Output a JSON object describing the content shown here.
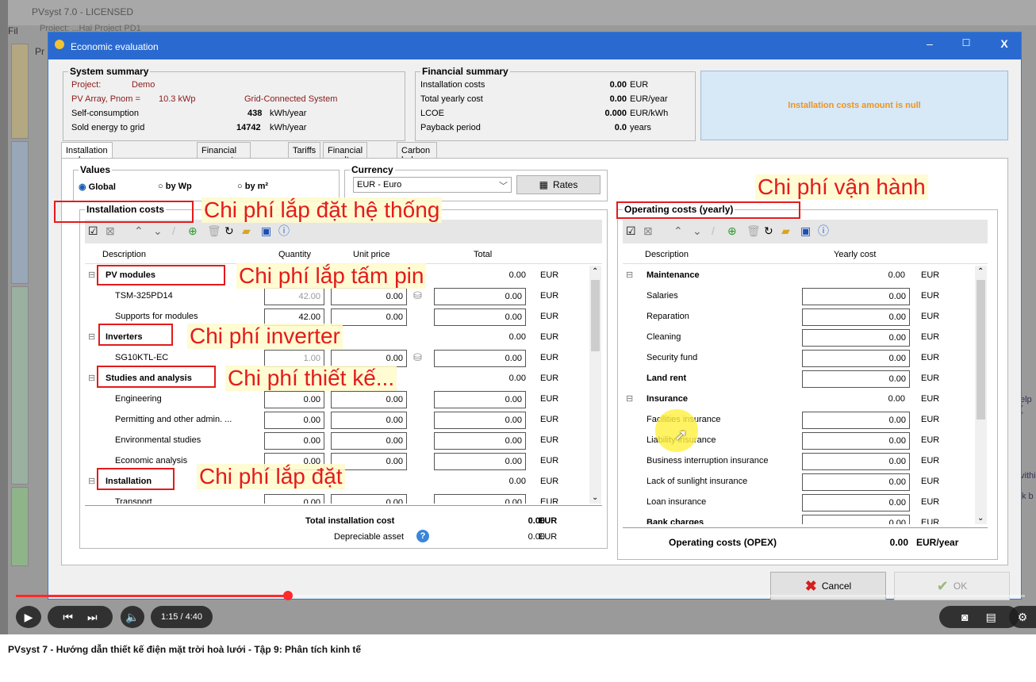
{
  "app": {
    "title": "PVsyst 7.0 - LICENSED",
    "menu": "Fil",
    "project_tab": "Pr",
    "project_bar": "Project: ...Hai Project PD1",
    "right_text_1": "elp (",
    "right_text_2": "vithi",
    "right_text_3": "k b"
  },
  "dialog": {
    "title": "Economic evaluation",
    "minimize": "–",
    "maximize": "☐",
    "close": "X"
  },
  "system_summary": {
    "legend": "System summary",
    "project_label": "Project:",
    "project_value": "Demo",
    "pv_label": "PV Array, Pnom =",
    "pv_value": "10.3 kWp",
    "pv_type": "Grid-Connected System",
    "selfc_label": "Self-consumption",
    "selfc_value": "438",
    "selfc_unit": "kWh/year",
    "sold_label": "Sold energy to grid",
    "sold_value": "14742",
    "sold_unit": "kWh/year"
  },
  "financial_summary": {
    "legend": "Financial summary",
    "rows": [
      {
        "label": "Installation costs",
        "value": "0.00",
        "unit": "EUR"
      },
      {
        "label": "Total yearly cost",
        "value": "0.00",
        "unit": "EUR/year"
      },
      {
        "label": "LCOE",
        "value": "0.000",
        "unit": "EUR/kWh"
      },
      {
        "label": "Payback period",
        "value": "0.0",
        "unit": "years"
      }
    ]
  },
  "warning": "Installation costs amount is null",
  "tabs": [
    "Installation and operating costs",
    "Financial parameters",
    "Tariffs",
    "Financial results",
    "Carbon balance"
  ],
  "values_group": {
    "legend": "Values",
    "options": [
      "Global",
      "by Wp",
      "by m²"
    ],
    "selected": "Global"
  },
  "currency_group": {
    "legend": "Currency",
    "selected": "EUR - Euro",
    "rates_label": "Rates"
  },
  "installation": {
    "legend": "Installation costs",
    "headers": {
      "description": "Description",
      "quantity": "Quantity",
      "unit_price": "Unit price",
      "total": "Total"
    },
    "rows": [
      {
        "desc": "PV modules",
        "group": true,
        "total": "0.00",
        "cur": "EUR"
      },
      {
        "desc": "TSM-325PD14",
        "qty": "42.00",
        "qty_gray": true,
        "price": "0.00",
        "db": true,
        "total": "0.00",
        "cur": "EUR"
      },
      {
        "desc": "Supports for modules",
        "qty": "42.00",
        "price": "0.00",
        "total": "0.00",
        "cur": "EUR"
      },
      {
        "desc": "Inverters",
        "group": true,
        "total": "0.00",
        "cur": "EUR"
      },
      {
        "desc": "SG10KTL-EC",
        "qty": "1.00",
        "qty_gray": true,
        "price": "0.00",
        "db": true,
        "total": "0.00",
        "cur": "EUR"
      },
      {
        "desc": "Studies and analysis",
        "group": true,
        "total": "0.00",
        "cur": "EUR"
      },
      {
        "desc": "Engineering",
        "qty": "0.00",
        "price": "0.00",
        "total": "0.00",
        "cur": "EUR"
      },
      {
        "desc": "Permitting and other admin. ...",
        "qty": "0.00",
        "price": "0.00",
        "total": "0.00",
        "cur": "EUR"
      },
      {
        "desc": "Environmental studies",
        "qty": "0.00",
        "price": "0.00",
        "total": "0.00",
        "cur": "EUR"
      },
      {
        "desc": "Economic analysis",
        "qty": "0.00",
        "price": "0.00",
        "total": "0.00",
        "cur": "EUR"
      },
      {
        "desc": "Installation",
        "group": true,
        "total": "0.00",
        "cur": "EUR"
      },
      {
        "desc": "Transport",
        "qty": "0.00",
        "price": "0.00",
        "total": "0.00",
        "cur": "EUR"
      }
    ],
    "total_label": "Total installation cost",
    "total_value": "0.00",
    "total_cur": "EUR",
    "dep_label": "Depreciable asset",
    "dep_value": "0.00",
    "dep_cur": "EUR"
  },
  "operating": {
    "legend": "Operating costs (yearly)",
    "headers": {
      "description": "Description",
      "yearly": "Yearly cost"
    },
    "rows": [
      {
        "desc": "Maintenance",
        "group": true,
        "total": "0.00",
        "cur": "EUR"
      },
      {
        "desc": "Salaries",
        "total": "0.00",
        "cur": "EUR"
      },
      {
        "desc": "Reparation",
        "total": "0.00",
        "cur": "EUR"
      },
      {
        "desc": "Cleaning",
        "total": "0.00",
        "cur": "EUR"
      },
      {
        "desc": "Security fund",
        "total": "0.00",
        "cur": "EUR"
      },
      {
        "desc": "Land rent",
        "boldonly": true,
        "total": "0.00",
        "cur": "EUR"
      },
      {
        "desc": "Insurance",
        "group": true,
        "total": "0.00",
        "cur": "EUR"
      },
      {
        "desc": "Facilities insurance",
        "total": "0.00",
        "cur": "EUR"
      },
      {
        "desc": "Liability insurance",
        "total": "0.00",
        "cur": "EUR"
      },
      {
        "desc": "Business interruption insurance",
        "total": "0.00",
        "cur": "EUR"
      },
      {
        "desc": "Lack of sunlight insurance",
        "total": "0.00",
        "cur": "EUR"
      },
      {
        "desc": "Loan insurance",
        "total": "0.00",
        "cur": "EUR"
      },
      {
        "desc": "Bank charges",
        "boldonly": true,
        "total": "0.00",
        "cur": "EUR"
      }
    ],
    "opex_label": "Operating costs (OPEX)",
    "opex_value": "0.00",
    "opex_unit": "EUR/year"
  },
  "buttons": {
    "cancel": "Cancel",
    "ok": "OK"
  },
  "annotations": {
    "installation": "Chi phí lắp đặt hệ thống",
    "pv_modules": "Chi phí lắp tấm pin",
    "inverters": "Chi phí inverter",
    "studies": "Chi phí thiết kế...",
    "install": "Chi phí lắp đặt",
    "operating": "Chi phí vận hành"
  },
  "player": {
    "time": "1:15 / 4:40",
    "progress_fraction": 0.27
  },
  "caption": "PVsyst 7 - Hướng dẫn thiết kế điện mặt trời hoà lưới - Tập 9: Phân tích kinh tế"
}
